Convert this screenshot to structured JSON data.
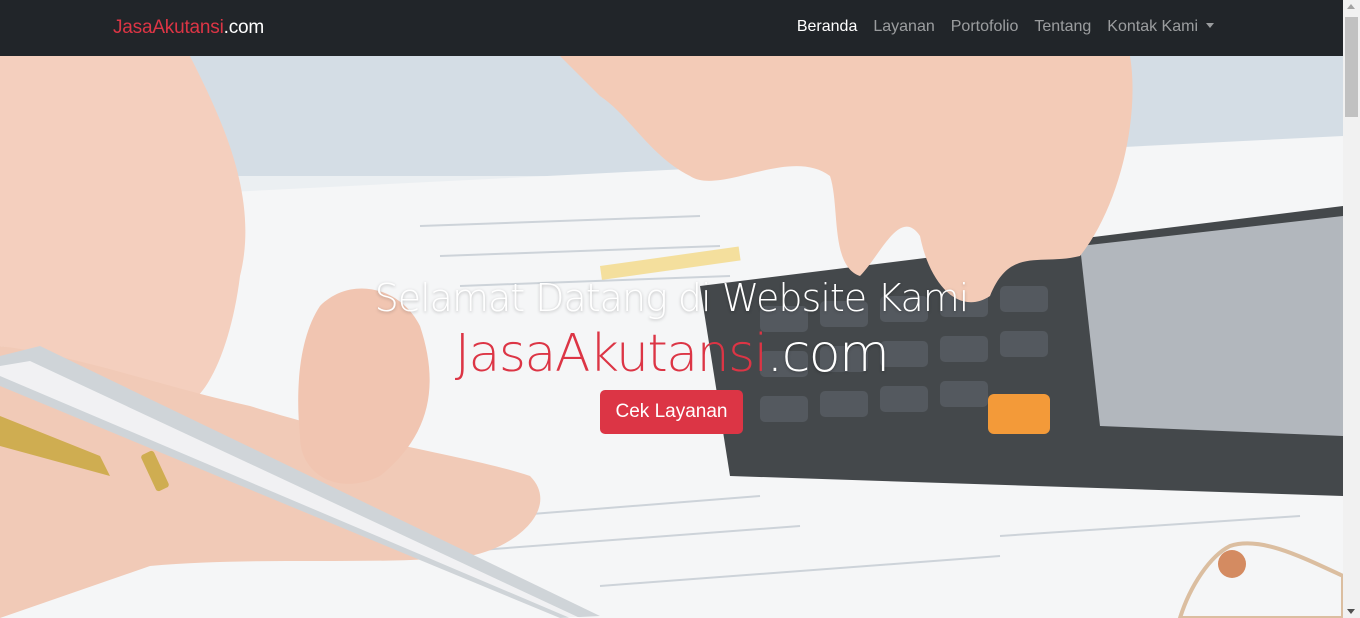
{
  "navbar": {
    "brand_red": "JasaAkutansi",
    "brand_white": ".com",
    "links": [
      {
        "label": "Beranda"
      },
      {
        "label": "Layanan"
      },
      {
        "label": "Portofolio"
      },
      {
        "label": "Tentang"
      },
      {
        "label": "Kontak Kami"
      }
    ]
  },
  "hero": {
    "subtitle": "Selamat Datang di Website Kami",
    "title_red": "JasaAkutansi",
    "title_white": ".com",
    "button_label": "Cek Layanan"
  },
  "colors": {
    "navbar_bg": "#212529",
    "accent": "#dc3545"
  },
  "icons": {
    "dropdown": "caret-down-icon"
  }
}
